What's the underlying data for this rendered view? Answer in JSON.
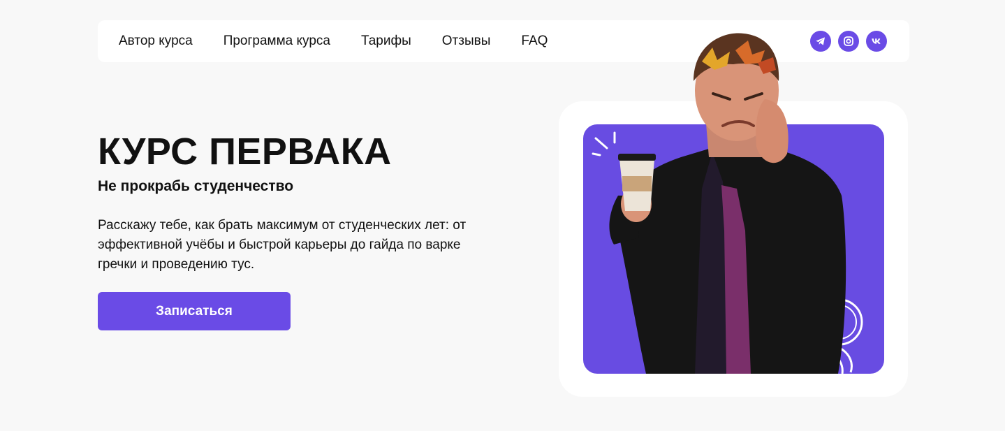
{
  "nav": {
    "links": [
      {
        "label": "Автор курса"
      },
      {
        "label": "Программа курса"
      },
      {
        "label": "Тарифы"
      },
      {
        "label": "Отзывы"
      },
      {
        "label": "FAQ"
      }
    ],
    "socials": [
      {
        "icon": "telegram-icon"
      },
      {
        "icon": "instagram-icon"
      },
      {
        "icon": "vk-icon"
      }
    ]
  },
  "hero": {
    "title": "КУРС ПЕРВАКА",
    "subtitle": "Не прокрабь студенчество",
    "description": "Расскажу тебе, как брать максимум от студенческих лет: от эффективной учёбы и быстрой карьеры до гайда по варке гречки и проведению тус.",
    "cta_label": "Записаться"
  },
  "colors": {
    "accent": "#6a4be6",
    "background": "#f8f8f8",
    "card": "#ffffff",
    "text": "#111111"
  }
}
